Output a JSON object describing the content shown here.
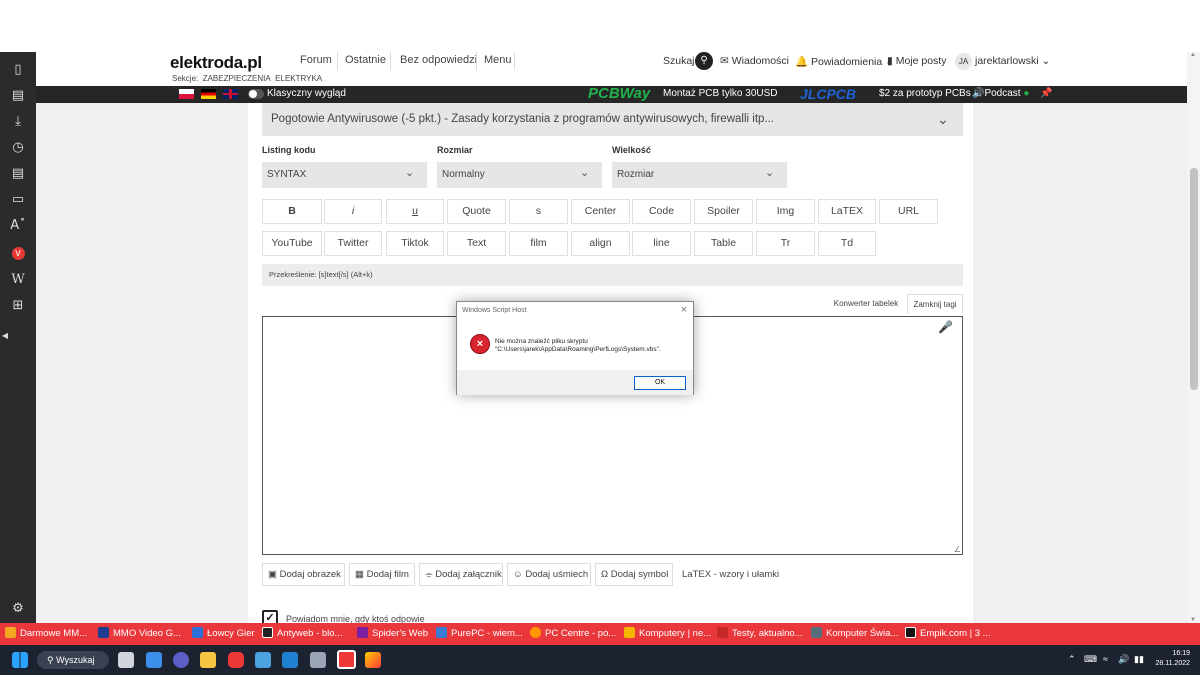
{
  "header": {
    "logo": "elektroda.pl",
    "sections_label": "Sekcje:",
    "section1": "ZABEZPIECZENIA",
    "section2": "ELEKTRYKA",
    "nav": [
      "Forum",
      "Ostatnie",
      "Bez odpowiedzi",
      "Menu"
    ],
    "search_label": "Szukaj",
    "messages": "Wiadomości",
    "notifications": "Powiadomienia",
    "my_posts": "Moje posty",
    "avatar_initials": "JA",
    "username": "jarektarlowski"
  },
  "darkbar": {
    "classic_view": "Klasyczny wygląd",
    "pcbway_logo": "PCBWay",
    "pcbway_text": "Montaż PCB tylko 30USD",
    "jlcpcb_logo": "JLCPCB",
    "jlcpcb_text": "$2 za prototyp PCBs",
    "podcast": "Podcast"
  },
  "form": {
    "forum": "Pogotowie Antywirusowe (-5 pkt.) - Zasady korzystania z programów antywirusowych, firewalli itp...",
    "code_label": "Listing kodu",
    "code_value": "SYNTAX",
    "size_label": "Rozmiar",
    "size_value": "Normalny",
    "magnitude_label": "Wielkość",
    "magnitude_value": "Rozmiar",
    "toolbar_row1": [
      "B",
      "i",
      "u",
      "Quote",
      "s",
      "Center",
      "Code",
      "Spoiler",
      "Img",
      "LaTEX",
      "URL"
    ],
    "toolbar_row2": [
      "YouTube",
      "Twitter",
      "Tiktok",
      "Text",
      "film",
      "align",
      "line",
      "Table",
      "Tr",
      "Td"
    ],
    "hint": "Przekreślenie: [s]text[/s] (Alt+k)",
    "table_converter": "Konwerter tabelek",
    "close_tags": "Zamknij tagi",
    "add_image": "Dodaj obrazek",
    "add_film": "Dodaj film",
    "add_attachment": "Dodaj załącznik",
    "add_smiley": "Dodaj uśmiech",
    "add_symbol": "Dodaj symbol",
    "latex_link": "LaTEX - wzory i ułamki",
    "notify": "Powiadom mnie, gdy ktoś odpowie"
  },
  "dialog": {
    "title": "Windows Script Host",
    "line1": "Nie można znaleźć pliku skryptu",
    "line2": "\"C:\\Users\\jarek\\AppData\\Roaming\\PerfLogs\\System.vbs\".",
    "ok": "OK"
  },
  "tabs": [
    {
      "label": "Darmowe MM...",
      "color": "#f5a623"
    },
    {
      "label": "MMO Video G...",
      "color": "#1b3d8f"
    },
    {
      "label": "Łowcy Gier",
      "color": "#2d6fd6"
    },
    {
      "label": "Antyweb - blo...",
      "color": "#222222"
    },
    {
      "label": "Spider's Web",
      "color": "#7b1fa2"
    },
    {
      "label": "PurePC - wiem...",
      "color": "#3a7bd5"
    },
    {
      "label": "PC Centre - po...",
      "color": "#ff9800"
    },
    {
      "label": "Komputery | ne...",
      "color": "#f4b400"
    },
    {
      "label": "Testy, aktualno...",
      "color": "#c62828"
    },
    {
      "label": "Komputer Świa...",
      "color": "#546e7a"
    },
    {
      "label": "Empik.com | 3 ...",
      "color": "#111111"
    }
  ],
  "taskbar": {
    "search": "Wyszukaj",
    "time": "16:19",
    "date": "28.11.2022"
  }
}
